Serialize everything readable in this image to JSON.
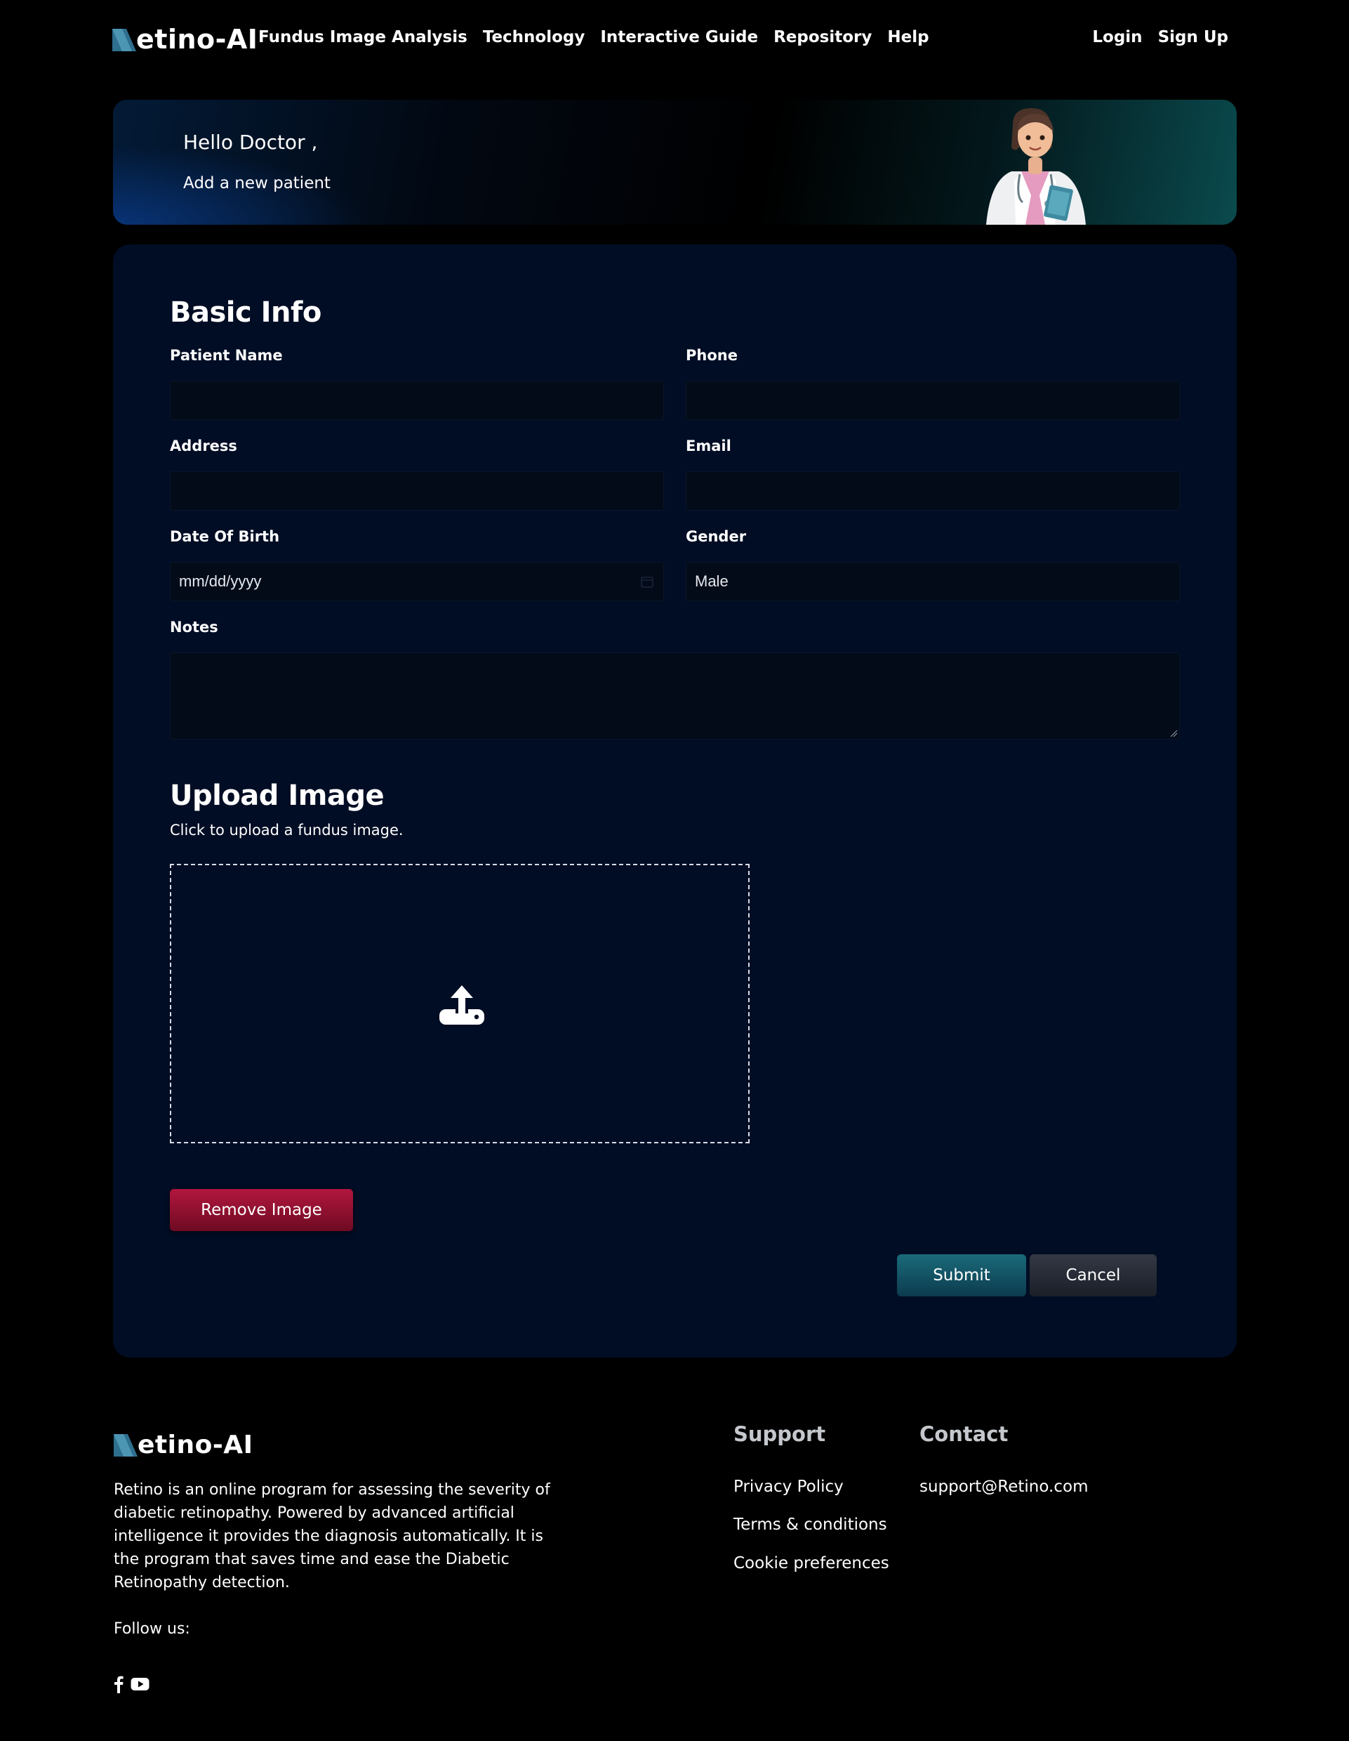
{
  "brand": {
    "name": "etino-AI"
  },
  "nav": {
    "links": [
      "Fundus Image Analysis",
      "Technology",
      "Interactive Guide",
      "Repository",
      "Help"
    ],
    "login": "Login",
    "signup": "Sign Up"
  },
  "hero": {
    "greeting": "Hello Doctor ,",
    "subtitle": "Add a new patient"
  },
  "form": {
    "basic_info_title": "Basic Info",
    "patient_name": {
      "label": "Patient Name",
      "value": ""
    },
    "phone": {
      "label": "Phone",
      "value": ""
    },
    "address": {
      "label": "Address",
      "value": ""
    },
    "email": {
      "label": "Email",
      "value": ""
    },
    "dob": {
      "label": "Date Of Birth",
      "placeholder": "mm/dd/yyyy"
    },
    "gender": {
      "label": "Gender",
      "value": "Male"
    },
    "notes": {
      "label": "Notes",
      "value": ""
    }
  },
  "upload": {
    "title": "Upload Image",
    "description": "Click to upload a fundus image.",
    "icon": "upload-icon"
  },
  "buttons": {
    "remove_image": "Remove Image",
    "submit": "Submit",
    "cancel": "Cancel"
  },
  "footer": {
    "description": "Retino is an online program for assessing the severity of diabetic retinopathy. Powered by advanced artificial intelligence it provides the diagnosis automatically. It is the program that saves time and ease the Diabetic Retinopathy detection.",
    "follow_us": "Follow us:",
    "social_icons": [
      "facebook-icon",
      "youtube-icon"
    ],
    "support": {
      "heading": "Support",
      "links": [
        "Privacy Policy",
        "Terms & conditions",
        "Cookie preferences"
      ]
    },
    "contact": {
      "heading": "Contact",
      "email": "support@Retino.com"
    }
  },
  "colors": {
    "background": "#000000",
    "card": "#010d24",
    "field": "#030b19",
    "remove": "#9b1235",
    "submit": "#145a6a",
    "cancel": "#262a33",
    "logo_accent": "#2f6f8e"
  }
}
